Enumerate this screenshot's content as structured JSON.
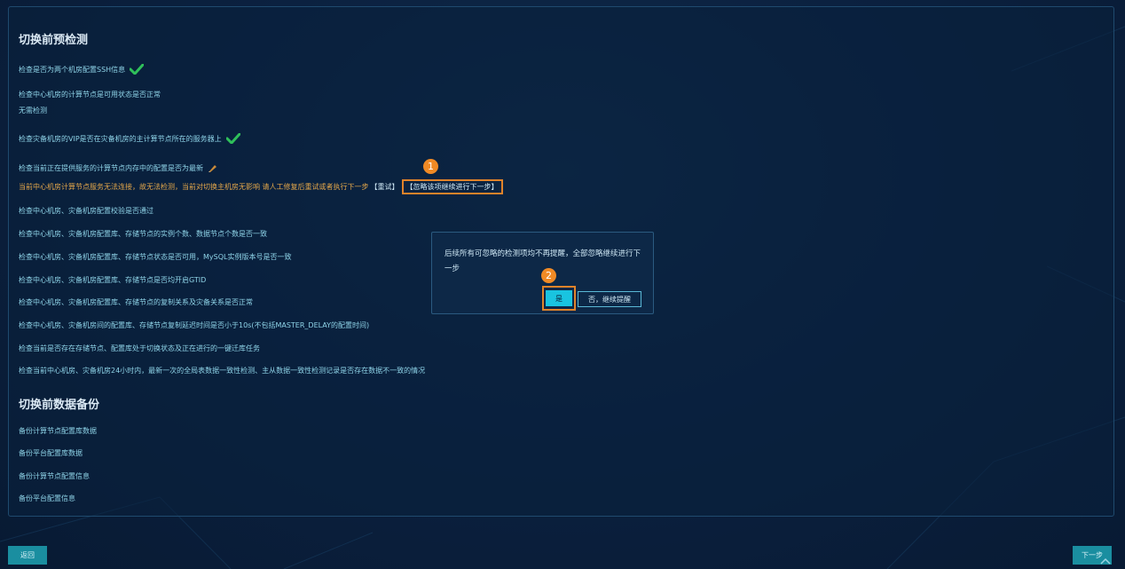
{
  "precheck": {
    "title": "切换前预检测",
    "items": [
      {
        "text": "检查是否为两个机房配置SSH信息"
      },
      {
        "text": "检查中心机房的计算节点是可用状态是否正常"
      },
      {
        "text": "无需检测"
      },
      {
        "text": "检查灾备机房的VIP是否在灾备机房的主计算节点所在的服务器上"
      },
      {
        "text": "检查当前正在提供服务的计算节点内存中的配置是否为最新"
      },
      {
        "text": "检查中心机房、灾备机房配置校验是否通过"
      },
      {
        "text": "检查中心机房、灾备机房配置库、存储节点的实例个数、数据节点个数是否一致"
      },
      {
        "text": "检查中心机房、灾备机房配置库、存储节点状态是否可用，MySQL实例版本号是否一致"
      },
      {
        "text": "检查中心机房、灾备机房配置库、存储节点是否均开启GTID"
      },
      {
        "text": "检查中心机房、灾备机房配置库、存储节点的复制关系及灾备关系是否正常"
      },
      {
        "text": "检查中心机房、灾备机房间的配置库、存储节点复制延迟时间是否小于10s(不包括MASTER_DELAY的配置时间)"
      },
      {
        "text": "检查当前是否存在存储节点、配置库处于切换状态及正在进行的一键迁库任务"
      },
      {
        "text": "检查当前中心机房、灾备机房24小时内，最新一次的全局表数据一致性检测、主从数据一致性检测记录是否存在数据不一致的情况"
      }
    ],
    "warning": {
      "text": "当前中心机房计算节点服务无法连接，故无法检测，当前对切换主机房无影响 请人工修复后重试或者执行下一步",
      "retry_label": "【重试】",
      "ignore_label": "【忽略该项继续进行下一步】"
    }
  },
  "backup": {
    "title": "切换前数据备份",
    "items": [
      {
        "text": "备份计算节点配置库数据"
      },
      {
        "text": "备份平台配置库数据"
      },
      {
        "text": "备份计算节点配置信息"
      },
      {
        "text": "备份平台配置信息"
      }
    ]
  },
  "dialog": {
    "message": "后续所有可忽略的检测项均不再提醒，全部忽略继续进行下一步",
    "yes_label": "是",
    "no_label": "否，继续提醒"
  },
  "badges": {
    "step1": "1",
    "step2": "2"
  },
  "footer": {
    "back_label": "返回",
    "next_label": "下一步"
  },
  "colors": {
    "accent": "#19c4e0",
    "highlight": "#e0832a",
    "success": "#2fbf5a",
    "warning_text": "#e3a64a"
  }
}
